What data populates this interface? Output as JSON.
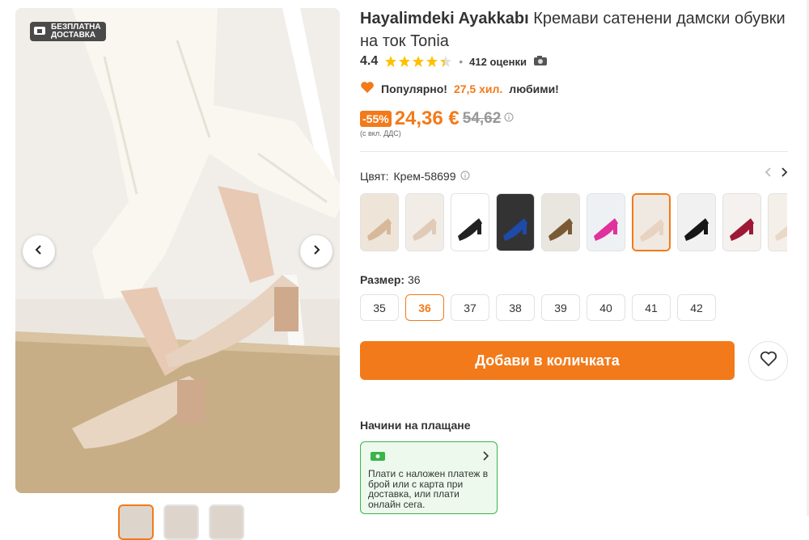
{
  "gallery": {
    "badge_line1": "БЕЗПЛАТНА",
    "badge_line2": "ДОСТАВКА"
  },
  "product": {
    "brand": "Hayalimdeki Ayakkabı",
    "name": "Кремави сатенени дамски обувки на ток Tonia"
  },
  "rating": {
    "score": "4.4",
    "stars_value": 4.4,
    "separator": "•",
    "count_label": "412 оценки"
  },
  "popularity": {
    "prefix": "Популярно!",
    "highlight": "27,5 хил.",
    "suffix": "любими!"
  },
  "price": {
    "discount": "-55%",
    "current": "24,36 €",
    "old": "54,62",
    "vat_note": "(с вкл. ДДС)"
  },
  "color": {
    "label": "Цвят:",
    "value": "Крем-58699",
    "selected_index": 6,
    "variants": [
      "beige",
      "nude",
      "white-black",
      "navy-blue",
      "leopard",
      "pink",
      "cream",
      "black",
      "burgundy",
      "nude-light"
    ]
  },
  "size": {
    "label": "Размер:",
    "selected": "36",
    "options": [
      "35",
      "36",
      "37",
      "38",
      "39",
      "40",
      "41",
      "42"
    ]
  },
  "actions": {
    "add_to_cart": "Добави в количката"
  },
  "payment": {
    "title": "Начини на плащане",
    "text": "Плати с наложен платеж в брой или с карта при доставка, или плати онлайн сега."
  },
  "colors": {
    "accent": "#f27a1a",
    "star": "#ffc000",
    "pay_border": "#39b54a"
  }
}
